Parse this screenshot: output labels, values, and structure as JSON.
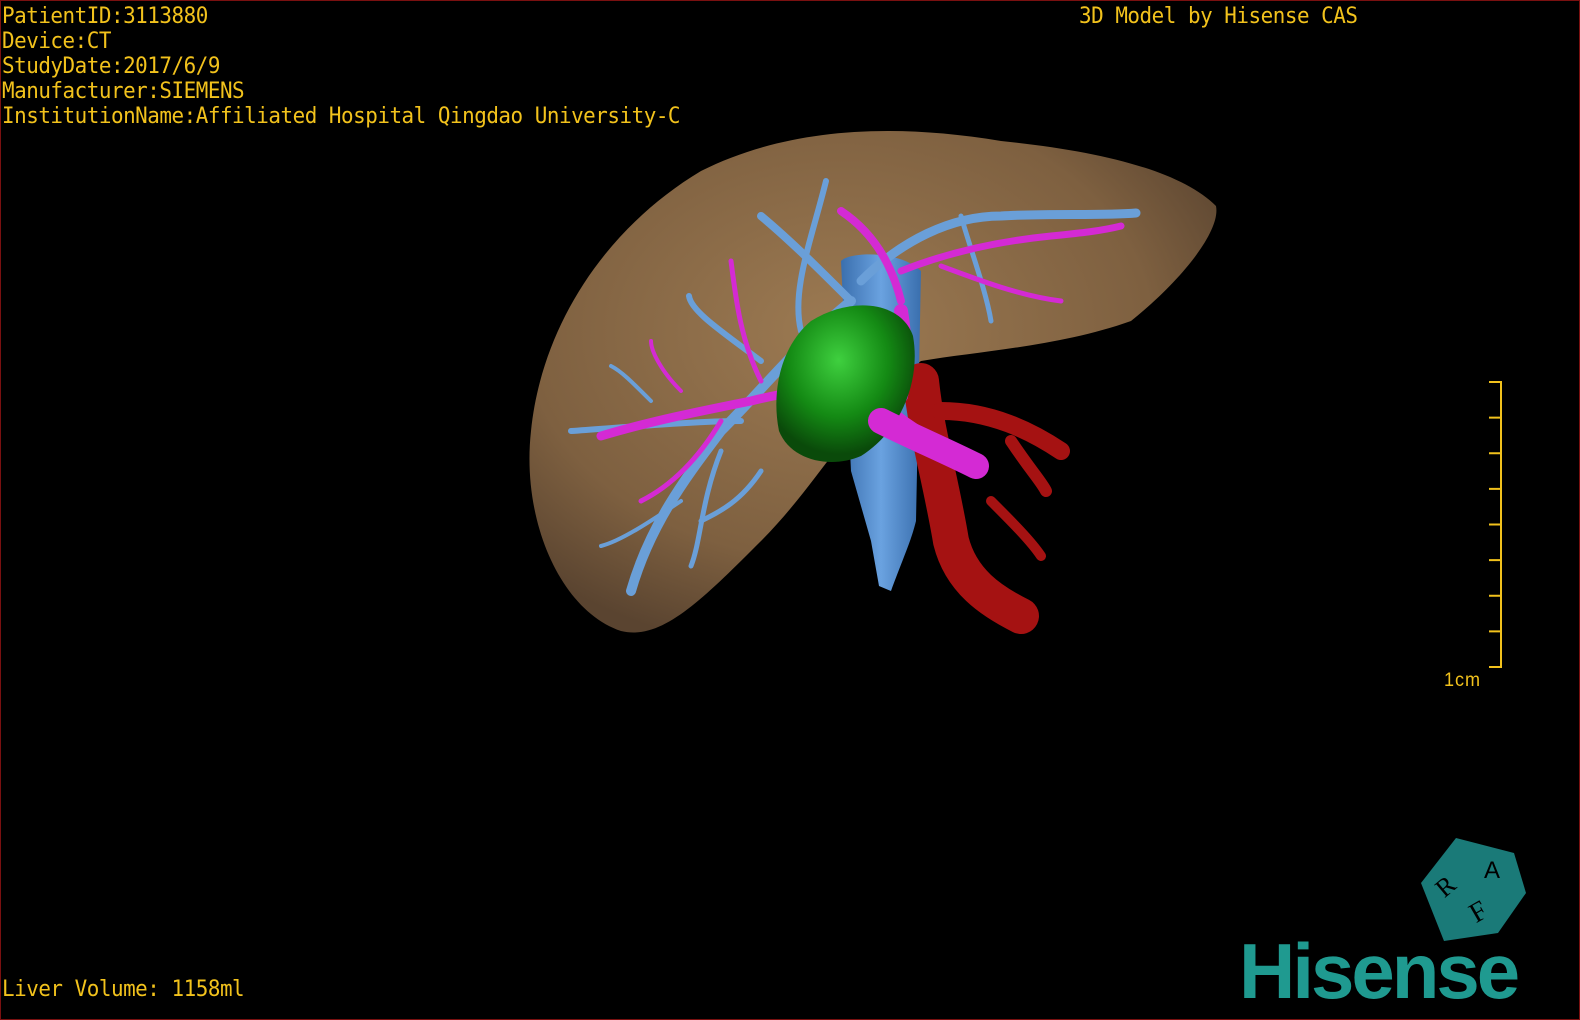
{
  "info": {
    "patient_id": "PatientID:3113880",
    "device": "Device:CT",
    "study_date": "StudyDate:2017/6/9",
    "manufacturer": "Manufacturer:SIEMENS",
    "institution": "InstitutionName:Affiliated Hospital Qingdao University-C"
  },
  "brand_text": "3D Model by Hisense CAS",
  "liver_volume": "Liver Volume: 1158ml",
  "scale_bar": {
    "label": "1cm",
    "ticks": 9
  },
  "orientation_cube": {
    "letters": [
      "R",
      "A",
      "F"
    ],
    "color": "#1a7a78"
  },
  "logo": {
    "text": "Hisense",
    "color": "#1f9a90"
  },
  "colors": {
    "overlay_text": "#f2c21c",
    "liver": "#8a6a45",
    "hepatic_vein": "#6a9fd8",
    "portal_vein": "#d42ad4",
    "tumor": "#1a8c1a",
    "artery": "#a01010"
  }
}
